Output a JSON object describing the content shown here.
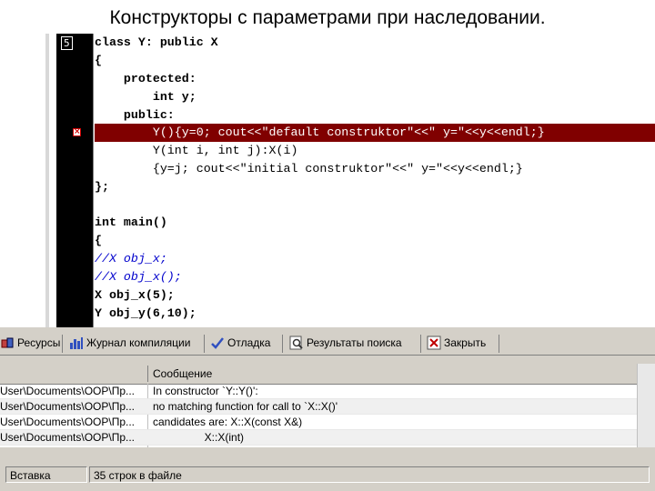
{
  "slide_title": "Конструкторы с параметрами при наследовании.",
  "editor": {
    "gutter_number": "5",
    "breakpoint_icon": "breakpoint-error-icon",
    "lines": [
      "class Y: public X",
      "{",
      "    protected:",
      "        int y;",
      "    public:",
      "        Y(){y=0; cout<<\"default construktor\"<<\" y=\"<<y<<endl;}",
      "        Y(int i, int j):X(i)",
      "        {y=j; cout<<\"initial construktor\"<<\" y=\"<<y<<endl;}",
      "};",
      "",
      "int main()",
      "{",
      "//X obj_x;",
      "//X obj_x();",
      "X obj_x(5);",
      "Y obj_y(6,10);"
    ]
  },
  "tabs": [
    {
      "label": "Ресурсы",
      "icon": "resources-icon"
    },
    {
      "label": "Журнал компиляции",
      "icon": "compile-log-icon"
    },
    {
      "label": "Отладка",
      "icon": "debug-icon"
    },
    {
      "label": "Результаты поиска",
      "icon": "search-results-icon"
    },
    {
      "label": "Закрыть",
      "icon": "close-icon"
    }
  ],
  "messages": {
    "columns": [
      "",
      "Сообщение"
    ],
    "rows": [
      {
        "file": "User\\Documents\\OOP\\Пр...",
        "message": "In constructor `Y::Y()':"
      },
      {
        "file": "User\\Documents\\OOP\\Пр...",
        "message": "no matching function for call to `X::X()'"
      },
      {
        "file": "User\\Documents\\OOP\\Пр...",
        "message": "candidates are: X::X(const X&)"
      },
      {
        "file": "User\\Documents\\OOP\\Пр...",
        "message": "                 X::X(int)"
      }
    ]
  },
  "status": {
    "mode": "Вставка",
    "lines_info": "35 строк в файле"
  }
}
